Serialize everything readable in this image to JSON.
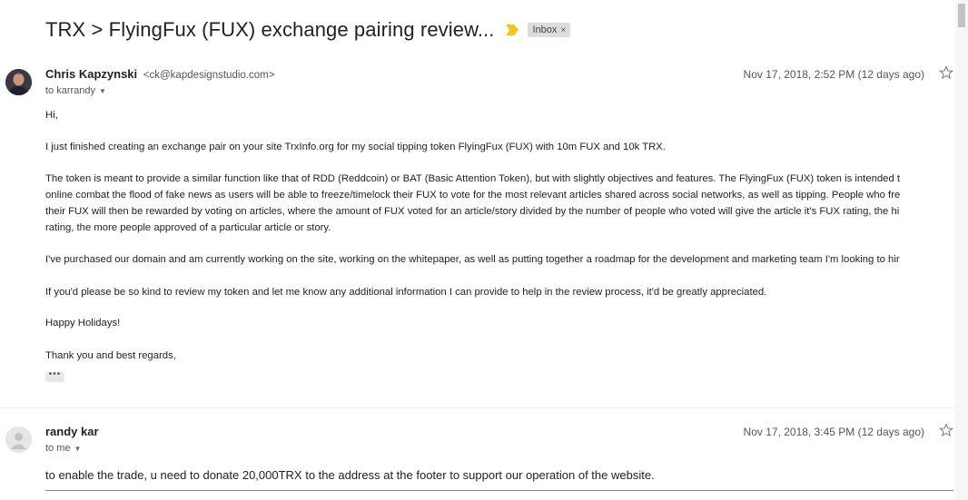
{
  "thread": {
    "subject": "TRX > FlyingFux (FUX) exchange pairing review...",
    "label": "Inbox",
    "label_remove": "×"
  },
  "icons": {
    "important": "important-marker-icon",
    "star": "star-icon",
    "dropdown": "chevron-down-icon",
    "expand": "ellipsis-icon"
  },
  "colors": {
    "important_marker": "#f5c518",
    "label_chip": "#dddddd"
  },
  "messages": [
    {
      "sender_name": "Chris Kapzynski",
      "sender_email": "<ck@kapdesignstudio.com>",
      "to_text": "to karrandy",
      "date": "Nov 17, 2018, 2:52 PM (12 days ago)",
      "body": {
        "greeting": "Hi,",
        "p1": "I just finished creating an exchange pair on your site TrxInfo.org for my social tipping token FlyingFux (FUX) with 10m FUX and 10k TRX.",
        "p2_l1": "The token is meant to provide a similar function like that of RDD (Reddcoin) or BAT (Basic Attention Token), but with slightly objectives and features. The FlyingFux (FUX) token is intended t",
        "p2_l2": "online combat the flood of fake news as users will be able to freeze/timelock their FUX to vote for the most relevant articles shared across social networks, as well as tipping. People who fre",
        "p2_l3": "their FUX will then be rewarded by voting on articles, where the amount of FUX voted for an article/story divided by the number of people who voted will give the article it's FUX rating, the hi",
        "p2_l4": "rating, the more people approved of a particular article or story.",
        "p3": "I've purchased our domain and am currently working on the site, working on the whitepaper, as well as putting together a roadmap for the development and marketing team I'm looking to hir",
        "p4": "If you'd please be so kind to review my token and let me know any additional information I can provide to help in the review process, it'd be greatly appreciated.",
        "p5": "Happy Holidays!",
        "p6": "Thank you and best regards,",
        "trimmed": "•••"
      }
    },
    {
      "sender_name": "randy kar",
      "to_text": "to me",
      "date": "Nov 17, 2018, 3:45 PM (12 days ago)",
      "body": "to enable the trade, u need to donate 20,000TRX to the address at the footer to support our operation of the website."
    }
  ]
}
